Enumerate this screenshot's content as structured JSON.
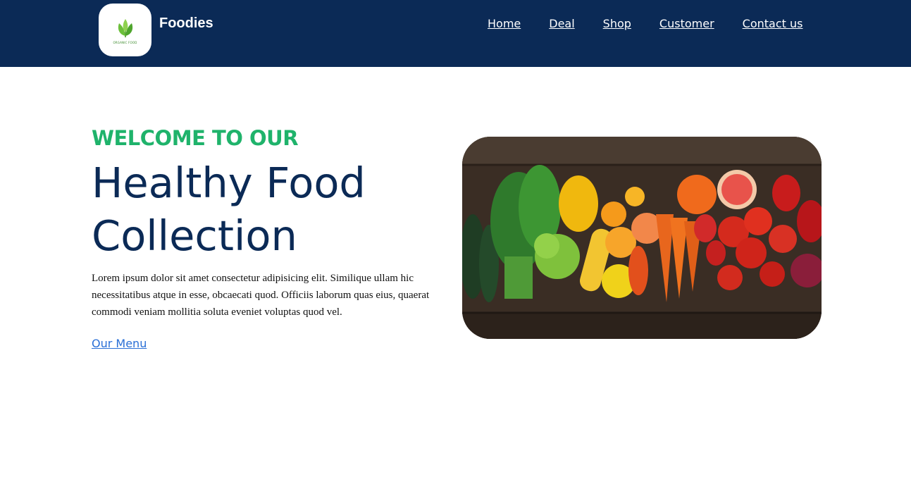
{
  "header": {
    "logo_caption": "ORGANIC FOOD",
    "brand": "Foodies",
    "nav": [
      {
        "label": "Home"
      },
      {
        "label": "Deal"
      },
      {
        "label": "Shop"
      },
      {
        "label": "Customer"
      },
      {
        "label": "Contact us"
      }
    ]
  },
  "hero": {
    "eyebrow": "WELCOME TO OUR",
    "title_line1": "Healthy Food",
    "title_line2": "Collection",
    "description": "Lorem ipsum dolor sit amet consectetur adipisicing elit. Similique ullam hic necessitatibus atque in esse, obcaecati quod. Officiis laborum quas eius, quaerat commodi veniam mollitia soluta eveniet voluptas quod vel.",
    "cta": "Our Menu",
    "image_icon": "vegetables-photo"
  },
  "colors": {
    "header_bg": "#0b2a56",
    "accent_green": "#1fb36b",
    "title_navy": "#0b2a56",
    "link_blue": "#2a6fd6"
  }
}
